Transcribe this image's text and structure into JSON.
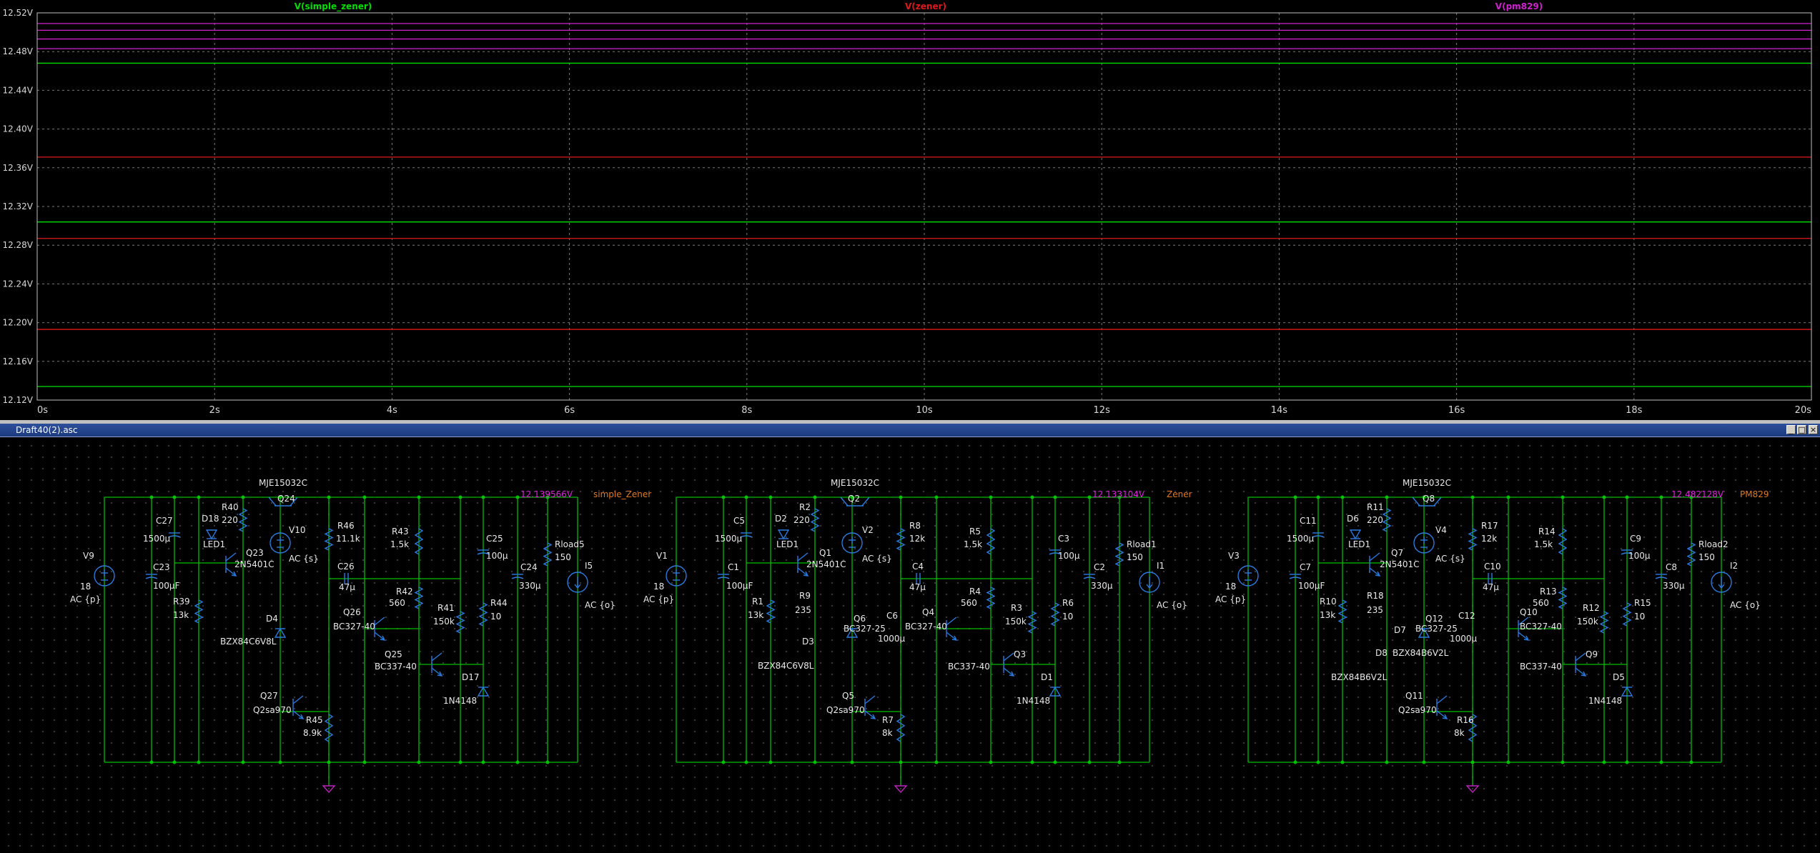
{
  "plot": {
    "traces": [
      {
        "name": "V(simple_zener)",
        "color": "#00e000",
        "levels": [
          12.468,
          12.304,
          12.134
        ]
      },
      {
        "name": "V(zener)",
        "color": "#e01818",
        "levels": [
          12.371,
          12.287,
          12.193
        ]
      },
      {
        "name": "V(pm829)",
        "color": "#d020d0",
        "levels": [
          12.509,
          12.502,
          12.493,
          12.483
        ]
      }
    ],
    "yaxis": {
      "min": 12.12,
      "max": 12.52,
      "ticks": [
        "12.52V",
        "12.48V",
        "12.44V",
        "12.40V",
        "12.36V",
        "12.32V",
        "12.28V",
        "12.24V",
        "12.20V",
        "12.16V",
        "12.12V"
      ]
    },
    "xaxis": {
      "min": 0,
      "max": 20,
      "ticks": [
        "0s",
        "2s",
        "4s",
        "6s",
        "8s",
        "10s",
        "12s",
        "14s",
        "16s",
        "18s",
        "20s"
      ]
    }
  },
  "schematic_window": {
    "title": "Draft40(2).asc",
    "buttons": [
      "_",
      "□",
      "×"
    ]
  },
  "schematic": {
    "colors": {
      "wire": "#00c000",
      "component": "#2a7be0",
      "text": "#e8e8e8",
      "label": "#e07820",
      "probe": "#e020e0",
      "ground": "#c020c0"
    },
    "texts": [
      [
        "MJE15032C",
        362,
        680
      ],
      [
        "Q24",
        388,
        702
      ],
      [
        "12.139566V",
        728,
        696
      ],
      [
        "simple_Zener",
        830,
        696
      ],
      [
        "C27",
        218,
        733
      ],
      [
        "1500µ",
        200,
        758
      ],
      [
        "D18",
        282,
        730
      ],
      [
        "LED1",
        284,
        766
      ],
      [
        "R40",
        310,
        714
      ],
      [
        "220",
        310,
        732
      ],
      [
        "V10",
        404,
        746
      ],
      [
        "AC {s}",
        404,
        786
      ],
      [
        "R46",
        472,
        740
      ],
      [
        "11.1k",
        470,
        758
      ],
      [
        "R43",
        548,
        748
      ],
      [
        "1.5k",
        546,
        766
      ],
      [
        "C25",
        680,
        758
      ],
      [
        "100µ",
        680,
        782
      ],
      [
        "Rload5",
        776,
        766
      ],
      [
        "150",
        776,
        784
      ],
      [
        "I5",
        818,
        796
      ],
      [
        "AC {o}",
        818,
        851
      ],
      [
        "V9",
        116,
        782
      ],
      [
        "18",
        112,
        825
      ],
      [
        "AC {p}",
        98,
        843
      ],
      [
        "C23",
        214,
        798
      ],
      [
        "100µF",
        214,
        824
      ],
      [
        "Q23",
        344,
        778
      ],
      [
        "2N5401C",
        328,
        794
      ],
      [
        "C26",
        472,
        797
      ],
      [
        "47µ",
        474,
        826
      ],
      [
        "R42",
        554,
        832
      ],
      [
        "560",
        544,
        848
      ],
      [
        "R41",
        612,
        855
      ],
      [
        "150k",
        606,
        874
      ],
      [
        "R44",
        686,
        848
      ],
      [
        "10",
        686,
        867
      ],
      [
        "C24",
        728,
        798
      ],
      [
        "330µ",
        726,
        824
      ],
      [
        "R39",
        242,
        846
      ],
      [
        "13k",
        242,
        865
      ],
      [
        "D4",
        372,
        870
      ],
      [
        "Q26",
        480,
        861
      ],
      [
        "BC327-40",
        466,
        881
      ],
      [
        "BZX84C6V8L",
        308,
        902
      ],
      [
        "Q25",
        538,
        920
      ],
      [
        "BC337-40",
        524,
        937
      ],
      [
        "D17",
        646,
        952
      ],
      [
        "1N4148",
        620,
        985
      ],
      [
        "Q27",
        364,
        978
      ],
      [
        "Q2sa970",
        354,
        998
      ],
      [
        "R45",
        428,
        1012
      ],
      [
        "8.9k",
        424,
        1030
      ],
      [
        "MJE15032C",
        1162,
        680
      ],
      [
        "Q2",
        1186,
        702
      ],
      [
        "12.133104V",
        1528,
        696
      ],
      [
        "Zener",
        1632,
        696
      ],
      [
        "C5",
        1026,
        733
      ],
      [
        "1500µ",
        1000,
        758
      ],
      [
        "D2",
        1084,
        730
      ],
      [
        "LED1",
        1086,
        766
      ],
      [
        "R2",
        1118,
        714
      ],
      [
        "220",
        1110,
        732
      ],
      [
        "V2",
        1206,
        746
      ],
      [
        "AC {s}",
        1206,
        786
      ],
      [
        "R8",
        1272,
        740
      ],
      [
        "12k",
        1272,
        758
      ],
      [
        "R5",
        1356,
        748
      ],
      [
        "1.5k",
        1348,
        766
      ],
      [
        "C3",
        1480,
        758
      ],
      [
        "100µ",
        1480,
        782
      ],
      [
        "Rload1",
        1576,
        766
      ],
      [
        "150",
        1576,
        784
      ],
      [
        "I1",
        1618,
        796
      ],
      [
        "AC {o}",
        1618,
        851
      ],
      [
        "V1",
        918,
        782
      ],
      [
        "18",
        914,
        825
      ],
      [
        "AC {p}",
        900,
        843
      ],
      [
        "C1",
        1018,
        798
      ],
      [
        "100µF",
        1016,
        824
      ],
      [
        "Q1",
        1146,
        778
      ],
      [
        "2N5401C",
        1128,
        794
      ],
      [
        "C4",
        1276,
        797
      ],
      [
        "47µ",
        1272,
        826
      ],
      [
        "R4",
        1356,
        832
      ],
      [
        "560",
        1344,
        848
      ],
      [
        "R3",
        1414,
        855
      ],
      [
        "150k",
        1406,
        874
      ],
      [
        "R6",
        1486,
        848
      ],
      [
        "10",
        1486,
        867
      ],
      [
        "C2",
        1530,
        798
      ],
      [
        "330µ",
        1526,
        824
      ],
      [
        "R1",
        1052,
        846
      ],
      [
        "13k",
        1046,
        865
      ],
      [
        "R9",
        1118,
        838
      ],
      [
        "235",
        1112,
        858
      ],
      [
        "Q6",
        1194,
        870
      ],
      [
        "BC327-25",
        1180,
        884
      ],
      [
        "C6",
        1240,
        866
      ],
      [
        "1000µ",
        1228,
        898
      ],
      [
        "Q4",
        1290,
        861
      ],
      [
        "BC327-40",
        1266,
        881
      ],
      [
        "D3",
        1122,
        902
      ],
      [
        "BZX84C6V8L",
        1060,
        936
      ],
      [
        "Q3",
        1418,
        920
      ],
      [
        "BC337-40",
        1326,
        937
      ],
      [
        "D1",
        1456,
        952
      ],
      [
        "1N4148",
        1422,
        985
      ],
      [
        "Q5",
        1178,
        978
      ],
      [
        "Q2sa970",
        1156,
        998
      ],
      [
        "R7",
        1234,
        1012
      ],
      [
        "8k",
        1234,
        1030
      ],
      [
        "MJE15032C",
        1962,
        680
      ],
      [
        "Q8",
        1990,
        702
      ],
      [
        "12.482128V",
        2338,
        696
      ],
      [
        "PM829",
        2434,
        696
      ],
      [
        "C11",
        1818,
        733
      ],
      [
        "1500µ",
        1800,
        758
      ],
      [
        "D6",
        1884,
        730
      ],
      [
        "LED1",
        1886,
        766
      ],
      [
        "R11",
        1912,
        714
      ],
      [
        "220",
        1912,
        732
      ],
      [
        "V4",
        2008,
        746
      ],
      [
        "AC {s}",
        2008,
        786
      ],
      [
        "R17",
        2072,
        740
      ],
      [
        "12k",
        2072,
        758
      ],
      [
        "R14",
        2152,
        748
      ],
      [
        "1.5k",
        2146,
        766
      ],
      [
        "C9",
        2280,
        758
      ],
      [
        "100µ",
        2278,
        782
      ],
      [
        "Rload2",
        2376,
        766
      ],
      [
        "150",
        2376,
        784
      ],
      [
        "I2",
        2420,
        796
      ],
      [
        "AC {o}",
        2420,
        851
      ],
      [
        "V3",
        1718,
        782
      ],
      [
        "18",
        1714,
        825
      ],
      [
        "AC {p}",
        1700,
        843
      ],
      [
        "C7",
        1818,
        798
      ],
      [
        "100µF",
        1816,
        824
      ],
      [
        "Q7",
        1946,
        778
      ],
      [
        "2N5401C",
        1930,
        794
      ],
      [
        "C10",
        2076,
        797
      ],
      [
        "47µ",
        2074,
        826
      ],
      [
        "R13",
        2154,
        832
      ],
      [
        "560",
        2144,
        848
      ],
      [
        "R12",
        2214,
        855
      ],
      [
        "150k",
        2206,
        874
      ],
      [
        "R15",
        2286,
        848
      ],
      [
        "10",
        2286,
        867
      ],
      [
        "C8",
        2330,
        798
      ],
      [
        "330µ",
        2326,
        824
      ],
      [
        "R10",
        1846,
        846
      ],
      [
        "13k",
        1846,
        865
      ],
      [
        "R18",
        1912,
        838
      ],
      [
        "235",
        1912,
        858
      ],
      [
        "Q12",
        1994,
        870
      ],
      [
        "BC327-25",
        1980,
        884
      ],
      [
        "C12",
        2040,
        866
      ],
      [
        "1000µ",
        2028,
        898
      ],
      [
        "Q10",
        2126,
        861
      ],
      [
        "BC327-40",
        2126,
        881
      ],
      [
        "D7",
        1950,
        886
      ],
      [
        "D8",
        1924,
        918
      ],
      [
        "BZX84B6V2L",
        1948,
        918
      ],
      [
        "BZX84B6V2L",
        1862,
        952
      ],
      [
        "Q9",
        2218,
        920
      ],
      [
        "BC337-40",
        2126,
        937
      ],
      [
        "D5",
        2256,
        952
      ],
      [
        "1N4148",
        2222,
        985
      ],
      [
        "Q11",
        1966,
        978
      ],
      [
        "Q2sa970",
        1956,
        998
      ],
      [
        "R16",
        2038,
        1012
      ],
      [
        "8k",
        2034,
        1030
      ]
    ]
  }
}
